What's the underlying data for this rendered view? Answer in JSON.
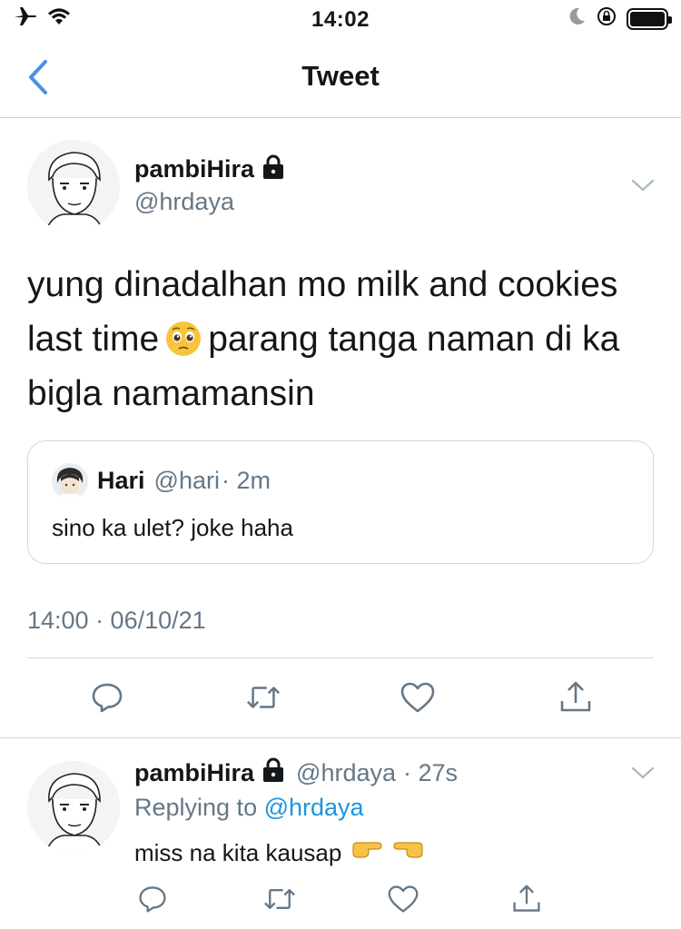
{
  "status_bar": {
    "time": "14:02",
    "icons": [
      "airplane-icon",
      "wifi-icon",
      "moon-icon",
      "orientation-lock-icon",
      "battery-icon"
    ]
  },
  "nav": {
    "title": "Tweet",
    "back_icon": "chevron-left-icon"
  },
  "tweet": {
    "name": "pambiHira",
    "handle": "@hrdaya",
    "protected_icon": "lock-icon",
    "text_before_emoji": "yung dinadalhan mo milk and cookies last time",
    "emoji": "pleading-face-emoji",
    "text_after_emoji": "parang tanga naman di ka bigla namamansin",
    "quoted": {
      "name": "Hari",
      "handle": "@hari",
      "time": "· 2m",
      "text": "sino ka ulet? joke haha"
    },
    "timestamp": "14:00 · 06/10/21"
  },
  "actions": [
    "reply-icon",
    "retweet-icon",
    "like-icon",
    "share-icon"
  ],
  "reply": {
    "name": "pambiHira",
    "handle": "@hrdaya",
    "time": "· 27s",
    "replying_label": "Replying to",
    "replying_to": "@hrdaya",
    "text": "miss na kita kausap",
    "emojis": [
      "pointing-right-emoji",
      "pointing-left-emoji"
    ]
  },
  "colors": {
    "text": "#14171a",
    "secondary": "#657786",
    "link": "#1b95e0",
    "back_chevron": "#4a90e2",
    "divider": "#d4d9dd"
  }
}
